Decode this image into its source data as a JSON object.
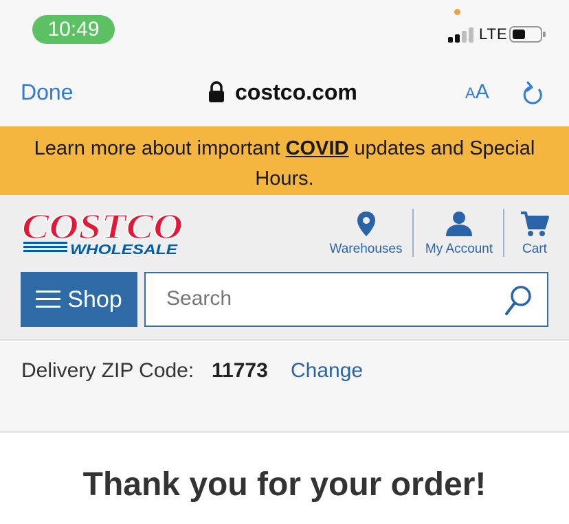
{
  "status_bar": {
    "time": "10:49",
    "network": "LTE"
  },
  "browser": {
    "done_label": "Done",
    "url": "costco.com",
    "aa_small": "A",
    "aa_big": "A"
  },
  "banner": {
    "prefix": "Learn more about important ",
    "link": "COVID",
    "suffix": " updates and Special Hours."
  },
  "header": {
    "logo": {
      "line1": "COSTCO",
      "line2": "WHOLESALE"
    },
    "nav": [
      {
        "label": "Warehouses",
        "icon": "location-pin-icon"
      },
      {
        "label": "My Account",
        "icon": "user-icon"
      },
      {
        "label": "Cart",
        "icon": "cart-icon"
      }
    ],
    "shop_label": "Shop",
    "search_placeholder": "Search"
  },
  "delivery": {
    "label": "Delivery ZIP Code:",
    "zip": "11773",
    "change_label": "Change"
  },
  "main": {
    "heading": "Thank you for your order!"
  },
  "colors": {
    "accent": "#2a64a8",
    "banner": "#f4b63f",
    "shop_button": "#2e6aa6",
    "time_pill": "#5cc163",
    "logo_red": "#e31837",
    "logo_blue": "#005daa"
  }
}
